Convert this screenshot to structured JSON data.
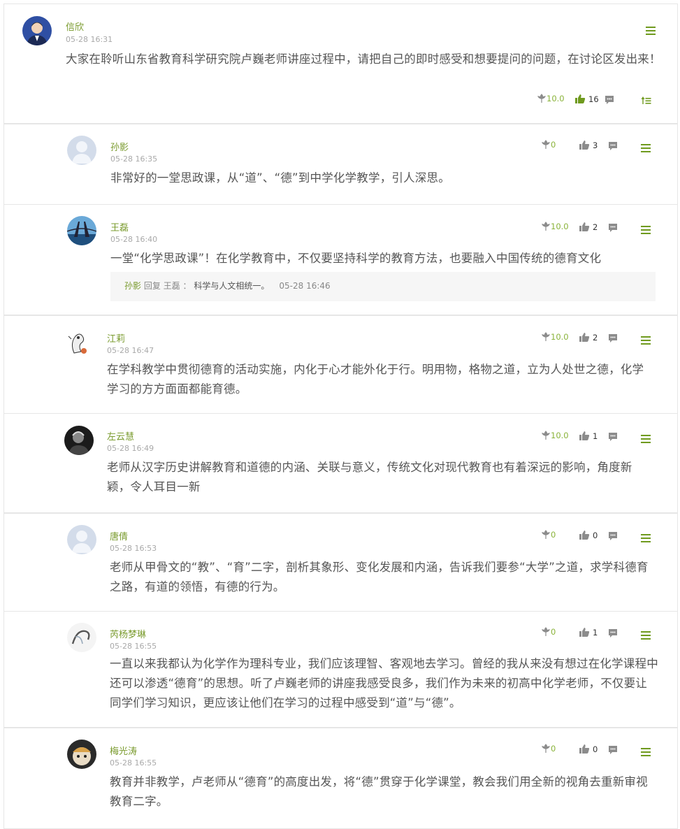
{
  "post": {
    "name": "信欣",
    "time": "05-28 16:31",
    "content": "大家在聆听山东省教育科学研究院卢巍老师讲座过程中，请把自己的即时感受和想要提问的问题，在讨论区发出来！",
    "flowers": "10.0",
    "likes": "16"
  },
  "comments": [
    {
      "name": "孙影",
      "time": "05-28 16:35",
      "flowers": "0",
      "likes": "3",
      "content": "非常好的一堂思政课，从“道”、“德”到中学化学教学，引人深思。"
    },
    {
      "name": "王磊",
      "time": "05-28 16:40",
      "flowers": "10.0",
      "likes": "2",
      "content": "一堂“化学思政课”！在化学教育中，不仅要坚持科学的教育方法，也要融入中国传统的德育文化",
      "reply": {
        "from": "孙影",
        "verb": "回复",
        "to": "王磊",
        "sep": "：",
        "text": "科学与人文相统一。",
        "time": "05-28 16:46"
      }
    },
    {
      "name": "江莉",
      "time": "05-28 16:47",
      "flowers": "10.0",
      "likes": "2",
      "content": "在学科教学中贯彻德育的活动实施，内化于心才能外化于行。明用物，格物之道，立为人处世之德，化学学习的方方面面都能育德。"
    },
    {
      "name": "左云慧",
      "time": "05-28 16:49",
      "flowers": "10.0",
      "likes": "1",
      "content": "老师从汉字历史讲解教育和道德的内涵、关联与意义，传统文化对现代教育也有着深远的影响，角度新颖，令人耳目一新"
    },
    {
      "name": "唐倩",
      "time": "05-28 16:53",
      "flowers": "0",
      "likes": "0",
      "content": "老师从甲骨文的“教”、“育”二字，剖析其象形、变化发展和内涵，告诉我们要参“大学”之道，求学科德育之路，有道的领悟，有德的行为。"
    },
    {
      "name": "芮杨梦琳",
      "time": "05-28 16:55",
      "flowers": "0",
      "likes": "1",
      "content": "一直以来我都认为化学作为理科专业，我们应该理智、客观地去学习。曾经的我从来没有想过在化学课程中还可以渗透“德育”的思想。听了卢巍老师的讲座我感受良多，我们作为未来的初高中化学老师，不仅要让同学们学习知识，更应该让他们在学习的过程中感受到“道”与“德”。"
    },
    {
      "name": "梅光涛",
      "time": "05-28 16:55",
      "flowers": "0",
      "likes": "0",
      "content": "教育并非教学，卢老师从“德育”的高度出发，将“德”贯穿于化学课堂，教会我们用全新的视角去重新审视教育二字。"
    }
  ],
  "icons": {
    "flower": "flower-icon",
    "like": "thumbs-up-icon",
    "comment": "comment-icon",
    "menu": "menu-icon",
    "collapse": "collapse-icon"
  },
  "colors": {
    "accent": "#7a9b2e",
    "flower": "#8ab33a",
    "like_active": "#6f9a1e",
    "icon_gray": "#8c8c8c"
  }
}
